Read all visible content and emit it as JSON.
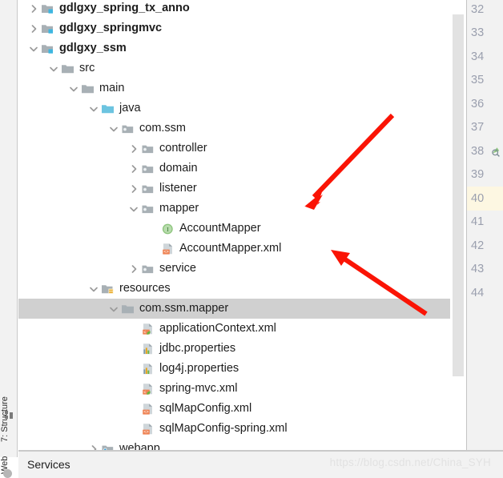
{
  "tree": {
    "rows": [
      {
        "label": "gdlgxy_spring_tx_anno",
        "indent": 0,
        "chevron": "right",
        "icon": "module-folder-icon",
        "bold": true,
        "selected": false
      },
      {
        "label": "gdlgxy_springmvc",
        "indent": 0,
        "chevron": "right",
        "icon": "module-folder-icon",
        "bold": true,
        "selected": false
      },
      {
        "label": "gdlgxy_ssm",
        "indent": 0,
        "chevron": "down",
        "icon": "module-folder-icon",
        "bold": true,
        "selected": false
      },
      {
        "label": "src",
        "indent": 1,
        "chevron": "down",
        "icon": "folder-icon",
        "bold": false,
        "selected": false
      },
      {
        "label": "main",
        "indent": 2,
        "chevron": "down",
        "icon": "folder-icon",
        "bold": false,
        "selected": false
      },
      {
        "label": "java",
        "indent": 3,
        "chevron": "down",
        "icon": "source-root-folder-icon",
        "bold": false,
        "selected": false
      },
      {
        "label": "com.ssm",
        "indent": 4,
        "chevron": "down",
        "icon": "package-icon",
        "bold": false,
        "selected": false
      },
      {
        "label": "controller",
        "indent": 5,
        "chevron": "right",
        "icon": "package-icon",
        "bold": false,
        "selected": false
      },
      {
        "label": "domain",
        "indent": 5,
        "chevron": "right",
        "icon": "package-icon",
        "bold": false,
        "selected": false
      },
      {
        "label": "listener",
        "indent": 5,
        "chevron": "right",
        "icon": "package-icon",
        "bold": false,
        "selected": false
      },
      {
        "label": "mapper",
        "indent": 5,
        "chevron": "down",
        "icon": "package-icon",
        "bold": false,
        "selected": false
      },
      {
        "label": "AccountMapper",
        "indent": 6,
        "chevron": "none",
        "icon": "java-interface-icon",
        "bold": false,
        "selected": false
      },
      {
        "label": "AccountMapper.xml",
        "indent": 6,
        "chevron": "none",
        "icon": "xml-file-icon",
        "bold": false,
        "selected": false
      },
      {
        "label": "service",
        "indent": 5,
        "chevron": "right",
        "icon": "package-icon",
        "bold": false,
        "selected": false
      },
      {
        "label": "resources",
        "indent": 3,
        "chevron": "down",
        "icon": "resource-root-folder-icon",
        "bold": false,
        "selected": false
      },
      {
        "label": "com.ssm.mapper",
        "indent": 4,
        "chevron": "down",
        "icon": "folder-icon",
        "bold": false,
        "selected": true
      },
      {
        "label": "applicationContext.xml",
        "indent": 5,
        "chevron": "none",
        "icon": "spring-xml-file-icon",
        "bold": false,
        "selected": false
      },
      {
        "label": "jdbc.properties",
        "indent": 5,
        "chevron": "none",
        "icon": "properties-file-icon",
        "bold": false,
        "selected": false
      },
      {
        "label": "log4j.properties",
        "indent": 5,
        "chevron": "none",
        "icon": "properties-file-icon",
        "bold": false,
        "selected": false
      },
      {
        "label": "spring-mvc.xml",
        "indent": 5,
        "chevron": "none",
        "icon": "spring-xml-file-icon",
        "bold": false,
        "selected": false
      },
      {
        "label": "sqlMapConfig.xml",
        "indent": 5,
        "chevron": "none",
        "icon": "xml-file-icon",
        "bold": false,
        "selected": false
      },
      {
        "label": "sqlMapConfig-spring.xml",
        "indent": 5,
        "chevron": "none",
        "icon": "xml-file-icon",
        "bold": false,
        "selected": false
      },
      {
        "label": "webapp",
        "indent": 3,
        "chevron": "right",
        "icon": "web-folder-icon",
        "bold": false,
        "selected": false
      }
    ]
  },
  "left_strip": {
    "structure_tool": "7: Structure",
    "web_tool": "Web"
  },
  "gutter": {
    "lines": [
      {
        "n": "32",
        "current": false,
        "badge": false
      },
      {
        "n": "33",
        "current": false,
        "badge": false
      },
      {
        "n": "34",
        "current": false,
        "badge": false
      },
      {
        "n": "35",
        "current": false,
        "badge": false
      },
      {
        "n": "36",
        "current": false,
        "badge": false
      },
      {
        "n": "37",
        "current": false,
        "badge": false
      },
      {
        "n": "38",
        "current": false,
        "badge": true
      },
      {
        "n": "39",
        "current": false,
        "badge": false
      },
      {
        "n": "40",
        "current": true,
        "badge": false
      },
      {
        "n": "41",
        "current": false,
        "badge": false
      },
      {
        "n": "42",
        "current": false,
        "badge": false
      },
      {
        "n": "43",
        "current": false,
        "badge": false
      },
      {
        "n": "44",
        "current": false,
        "badge": false
      }
    ]
  },
  "status_bar": {
    "services_label": "Services",
    "watermark": "https://blog.csdn.net/China_SYH"
  },
  "annotations": {
    "arrow_color": "#fa1405",
    "arrow1_target": "AccountMapper.xml",
    "arrow2_target": "com.ssm.mapper"
  },
  "colors": {
    "selection": "#d0d0d0",
    "current_line": "#fdf7e2",
    "source_root": "#6cc4e0",
    "resource_badge": "#f5bb2e",
    "xml_badge": "#ef8354",
    "interface_badge": "#8cc47c"
  }
}
